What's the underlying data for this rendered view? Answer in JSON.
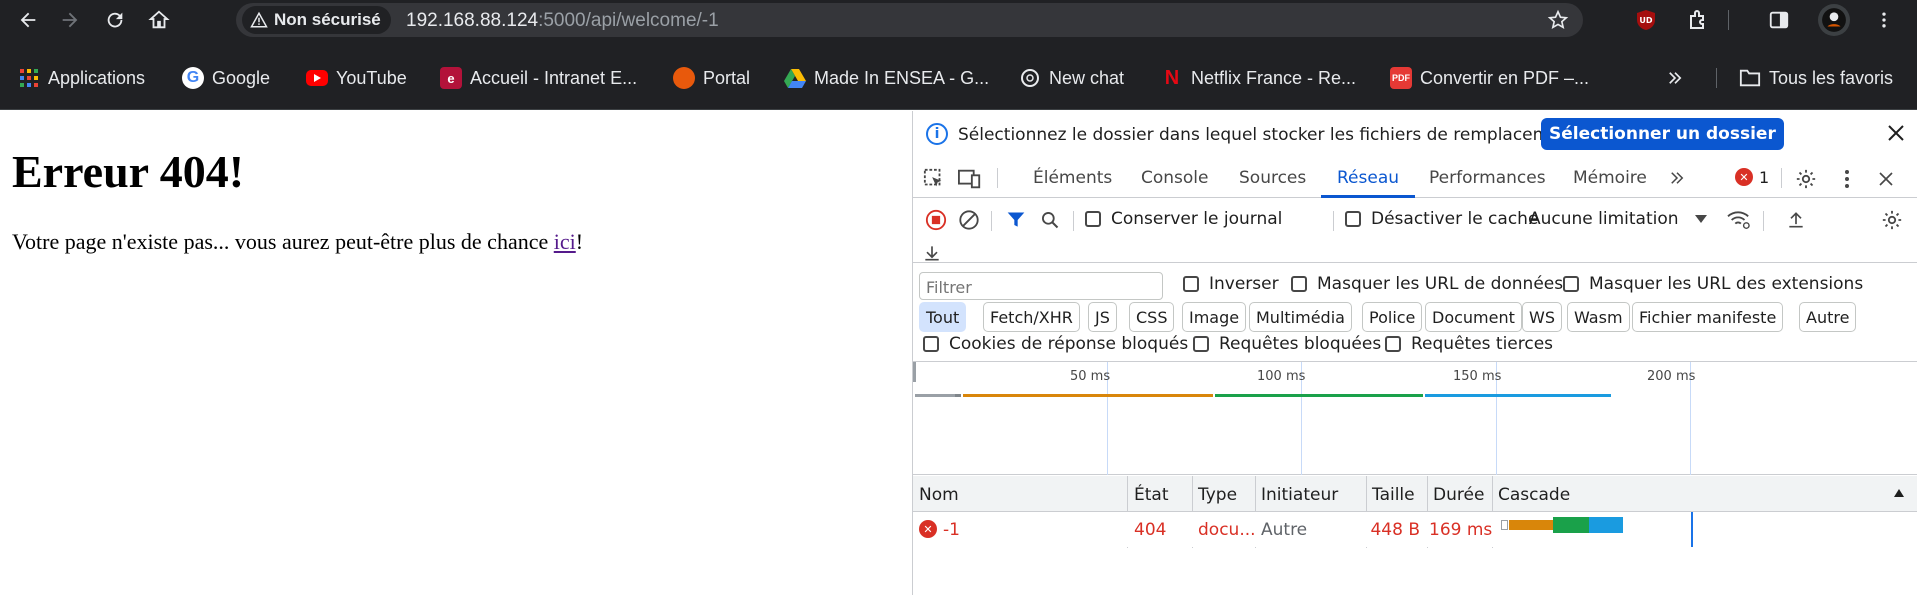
{
  "browser": {
    "security_chip": "Non sécurisé",
    "url_host": "192.168.88.124",
    "url_rest": ":5000/api/welcome/-1",
    "profile_badge": "UD"
  },
  "bookmarks": [
    {
      "label": "Applications",
      "icon": "apps-grid-icon"
    },
    {
      "label": "Google",
      "icon": "google-icon"
    },
    {
      "label": "YouTube",
      "icon": "youtube-icon"
    },
    {
      "label": "Accueil - Intranet E...",
      "icon": "ensea-icon"
    },
    {
      "label": "Portal",
      "icon": "portal-icon"
    },
    {
      "label": "Made In ENSEA - G...",
      "icon": "google-drive-icon"
    },
    {
      "label": "New chat",
      "icon": "chatgpt-icon"
    },
    {
      "label": "Netflix France - Re...",
      "icon": "netflix-icon"
    },
    {
      "label": "Convertir en PDF –...",
      "icon": "pdf-icon"
    },
    {
      "label": "Tous les favoris",
      "icon": "folder-icon"
    }
  ],
  "page": {
    "heading": "Erreur 404!",
    "text_before": "Votre page n'existe pas... vous aurez peut-être plus de chance ",
    "link": "ici",
    "text_after": "!"
  },
  "devtools": {
    "infobar_text": "Sélectionnez le dossier dans lequel stocker les fichiers de remplacement.",
    "infobar_button": "Sélectionner un dossier",
    "tabs": [
      "Éléments",
      "Console",
      "Sources",
      "Réseau",
      "Performances",
      "Mémoire"
    ],
    "active_tab": "Réseau",
    "error_count": "1",
    "preserve_log": "Conserver le journal",
    "disable_cache": "Désactiver le cache",
    "throttling": "Aucune limitation",
    "filter_placeholder": "Filtrer",
    "invert": "Inverser",
    "hide_data_urls": "Masquer les URL de données",
    "hide_extension_urls": "Masquer les URL des extensions",
    "chips": [
      "Tout",
      "Fetch/XHR",
      "JS",
      "CSS",
      "Image",
      "Multimédia",
      "Police",
      "Document",
      "WS",
      "Wasm",
      "Fichier manifeste",
      "Autre"
    ],
    "blocked_cookies": "Cookies de réponse bloqués",
    "blocked_requests": "Requêtes bloquées",
    "third_party": "Requêtes tierces",
    "timeline_ticks": [
      "50 ms",
      "100 ms",
      "150 ms",
      "200 ms"
    ],
    "columns": [
      "Nom",
      "État",
      "Type",
      "Initiateur",
      "Taille",
      "Durée",
      "Cascade"
    ],
    "rows": [
      {
        "name": "-1",
        "status": "404",
        "type": "docu...",
        "initiator": "Autre",
        "size": "448 B",
        "time": "169 ms"
      }
    ]
  },
  "colors": {
    "accent": "#0b57d0",
    "error": "#d93025",
    "wait": "#d9860a",
    "download": "#1aa14a",
    "receive": "#1a9be0"
  }
}
